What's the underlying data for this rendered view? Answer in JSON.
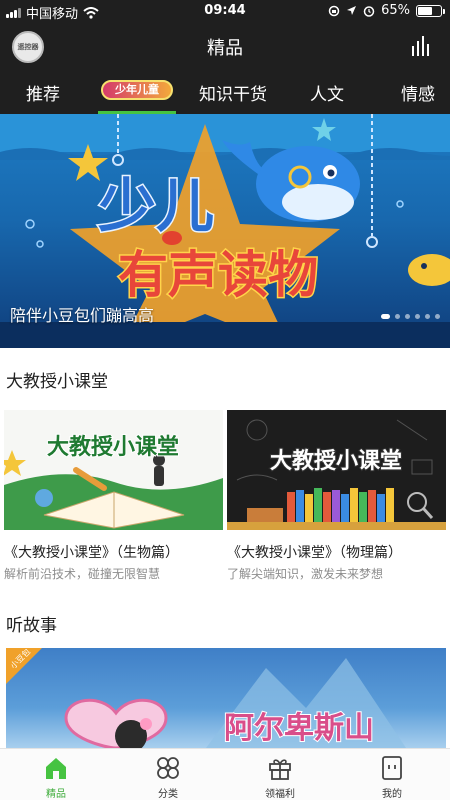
{
  "status_bar": {
    "carrier": "中国移动",
    "time": "09:44",
    "battery": "65%",
    "battery_level": 0.65
  },
  "header": {
    "avatar_text": "遥控器",
    "title": "精品"
  },
  "tabs": [
    {
      "label": "推荐"
    },
    {
      "label": "少年儿童",
      "badge": true,
      "active": true
    },
    {
      "label": "知识干货"
    },
    {
      "label": "人文"
    },
    {
      "label": "情感"
    }
  ],
  "banner": {
    "line1": "少儿",
    "line2": "有声读物",
    "caption": "陪伴小豆包们蹦高高",
    "page_count": 6,
    "active_page": 0
  },
  "sections": [
    {
      "title": "大教授小课堂",
      "cards": [
        {
          "image_text": "大教授小课堂",
          "title": "《大教授小课堂》（生物篇）",
          "subtitle": "解析前沿技术，碰撞无限智慧"
        },
        {
          "image_text": "大教授小课堂",
          "title": "《大教授小课堂》（物理篇）",
          "subtitle": "了解尖端知识，激发未来梦想"
        }
      ]
    },
    {
      "title": "听故事",
      "story": {
        "corner_tag": "小豆包",
        "image_text": "阿尔卑斯山"
      }
    }
  ],
  "bottom_nav": [
    {
      "label": "精品",
      "icon": "home-icon",
      "active": true
    },
    {
      "label": "分类",
      "icon": "category-icon"
    },
    {
      "label": "领福利",
      "icon": "gift-icon"
    },
    {
      "label": "我的",
      "icon": "profile-icon"
    }
  ],
  "colors": {
    "accent_green": "#46c341",
    "dark_header": "#1f1f1f",
    "banner_blue": "#1868ae"
  }
}
